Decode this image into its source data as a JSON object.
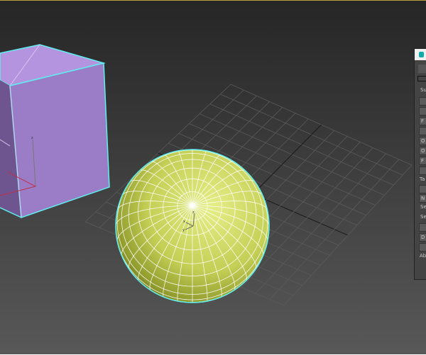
{
  "viewport": {
    "background": "#3a3a3a",
    "selection_color": "#5ff0f0"
  },
  "objects": [
    {
      "name": "Box",
      "color": "#a17fcc"
    },
    {
      "name": "Sphere",
      "color": "#c9d45a"
    }
  ],
  "gizmo": {
    "axis_x": "x",
    "axis_y": "y",
    "axis_z": "z"
  },
  "panel": {
    "section_1": "Su",
    "section_2": "Ta",
    "section_3": "Ab",
    "buttons": [
      "",
      "",
      "F",
      "",
      "O",
      "O",
      "F",
      "",
      "",
      "N",
      "Se",
      "Se",
      "",
      "D",
      ""
    ]
  }
}
